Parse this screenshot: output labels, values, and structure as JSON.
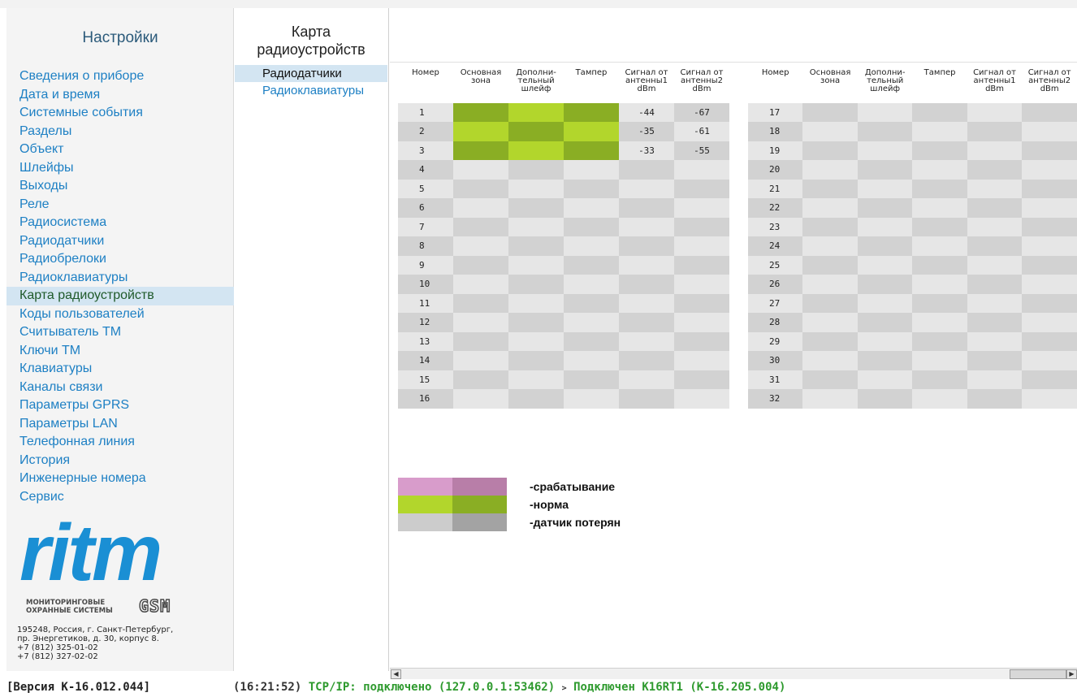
{
  "sidebar": {
    "title": "Настройки",
    "items": [
      {
        "label": "Сведения о приборе"
      },
      {
        "label": "Дата и время"
      },
      {
        "label": "Системные события"
      },
      {
        "label": "Разделы"
      },
      {
        "label": "Объект"
      },
      {
        "label": "Шлейфы"
      },
      {
        "label": "Выходы"
      },
      {
        "label": "Реле"
      },
      {
        "label": "Радиосистема"
      },
      {
        "label": "Радиодатчики"
      },
      {
        "label": "Радиобрелоки"
      },
      {
        "label": "Радиоклавиатуры"
      },
      {
        "label": "Карта радиоустройств",
        "active": true
      },
      {
        "label": "Коды пользователей"
      },
      {
        "label": "Считыватель ТМ"
      },
      {
        "label": "Ключи ТМ"
      },
      {
        "label": "Клавиатуры"
      },
      {
        "label": "Каналы связи"
      },
      {
        "label": "Параметры GPRS"
      },
      {
        "label": "Параметры LAN"
      },
      {
        "label": "Телефонная линия"
      },
      {
        "label": "История"
      },
      {
        "label": "Инженерные номера"
      },
      {
        "label": "Сервис"
      }
    ],
    "logo": {
      "text": "ritm",
      "subtitle": "МОНИТОРИНГОВЫЕ ОХРАННЫЕ СИСТЕМЫ",
      "gsm": "GSM"
    },
    "address": [
      "195248, Россия, г. Санкт-Петербург,",
      "пр. Энергетиков, д. 30, корпус 8.",
      "+7 (812) 325-01-02",
      "+7 (812) 327-02-02"
    ]
  },
  "submenu": {
    "title_line1": "Карта",
    "title_line2": "радиоустройств",
    "items": [
      {
        "label": "Радиодатчики",
        "active": true
      },
      {
        "label": "Радиоклавиатуры"
      }
    ]
  },
  "table": {
    "headers": [
      "Номер",
      "Основная зона",
      "Дополни-тельный шлейф",
      "Тампер",
      "Сигнал от антенны1 dBm",
      "Сигнал от антенны2 dBm"
    ],
    "rows_left": [
      {
        "num": "1",
        "zone": "norm",
        "loop": "norm",
        "tamper": "norm",
        "sig1": "-44",
        "sig2": "-67"
      },
      {
        "num": "2",
        "zone": "norm",
        "loop": "norm",
        "tamper": "norm",
        "sig1": "-35",
        "sig2": "-61"
      },
      {
        "num": "3",
        "zone": "norm",
        "loop": "norm",
        "tamper": "norm",
        "sig1": "-33",
        "sig2": "-55"
      },
      {
        "num": "4"
      },
      {
        "num": "5"
      },
      {
        "num": "6"
      },
      {
        "num": "7"
      },
      {
        "num": "8"
      },
      {
        "num": "9"
      },
      {
        "num": "10"
      },
      {
        "num": "11"
      },
      {
        "num": "12"
      },
      {
        "num": "13"
      },
      {
        "num": "14"
      },
      {
        "num": "15"
      },
      {
        "num": "16"
      }
    ],
    "rows_right": [
      {
        "num": "17"
      },
      {
        "num": "18"
      },
      {
        "num": "19"
      },
      {
        "num": "20"
      },
      {
        "num": "21"
      },
      {
        "num": "22"
      },
      {
        "num": "23"
      },
      {
        "num": "24"
      },
      {
        "num": "25"
      },
      {
        "num": "26"
      },
      {
        "num": "27"
      },
      {
        "num": "28"
      },
      {
        "num": "29"
      },
      {
        "num": "30"
      },
      {
        "num": "31"
      },
      {
        "num": "32"
      }
    ]
  },
  "legend": [
    {
      "label": "-срабатывание",
      "color_a": "#d89ccb",
      "color_b": "#b87ea8"
    },
    {
      "label": "-норма",
      "color_a": "#b2d62c",
      "color_b": "#8aae24"
    },
    {
      "label": "-датчик потерян",
      "color_a": "#cccccc",
      "color_b": "#a3a3a3"
    }
  ],
  "statusbar": {
    "version": "[Версия К-16.012.044]",
    "time": "(16:21:52)",
    "tcp": "TCP/IP: подключено (127.0.0.1:53462)",
    "arrow": ">",
    "device": "Подключен К16RT1 (К-16.205.004)"
  }
}
